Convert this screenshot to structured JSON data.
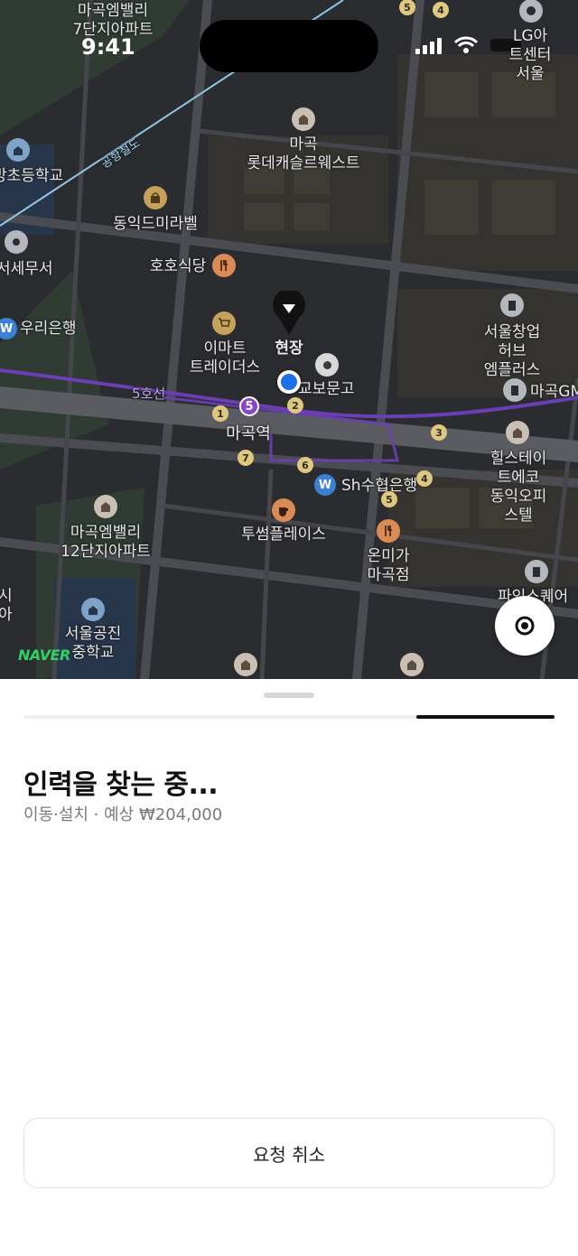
{
  "status_bar": {
    "time": "9:41"
  },
  "map": {
    "brand": "NAVER",
    "rail_label": "공항철도",
    "line_label": "5호선",
    "line5_badge": "5",
    "exit_numbers": [
      "1",
      "2",
      "3",
      "4",
      "5",
      "6",
      "7"
    ],
    "pin_label": "현장",
    "bank_icon_glyph": "W",
    "places": {
      "magok_7": "마곡엠밸리\n7단지아파트",
      "lg_art": "LG아트센터\n서울",
      "lotte_castle": "마곡\n롯데캐슬르웨스트",
      "school_top": "방초등학교",
      "dongik_mirabel": "동익드미라벨",
      "tax_office": "서세무서",
      "hoho": "호호식당",
      "woori": "우리은행",
      "emart": "이마트\n트레이더스",
      "kyobo": "교보문고",
      "seoul_changup": "서울창업허브\n엠플러스",
      "magok_gm": "마곡GM",
      "magok_station": "마곡역",
      "hills": "힐스테이트에코\n동익오피스텔",
      "sh_bank": "Sh수협은행",
      "magok_12": "마곡엠밸리\n12단지아파트",
      "twosome": "투썸플레이스",
      "onmiga": "온미가\n마곡점",
      "square": "파인스퀘어",
      "gongjin": "서울공진\n중학교",
      "left_edge": "시\n아"
    }
  },
  "locate_button": {
    "icon": "target-icon"
  },
  "sheet": {
    "progress": 0.26,
    "title": "인력을 찾는 중...",
    "subtitle": "이동·설치 · 예상 ₩204,000",
    "cancel_label": "요청 취소"
  }
}
